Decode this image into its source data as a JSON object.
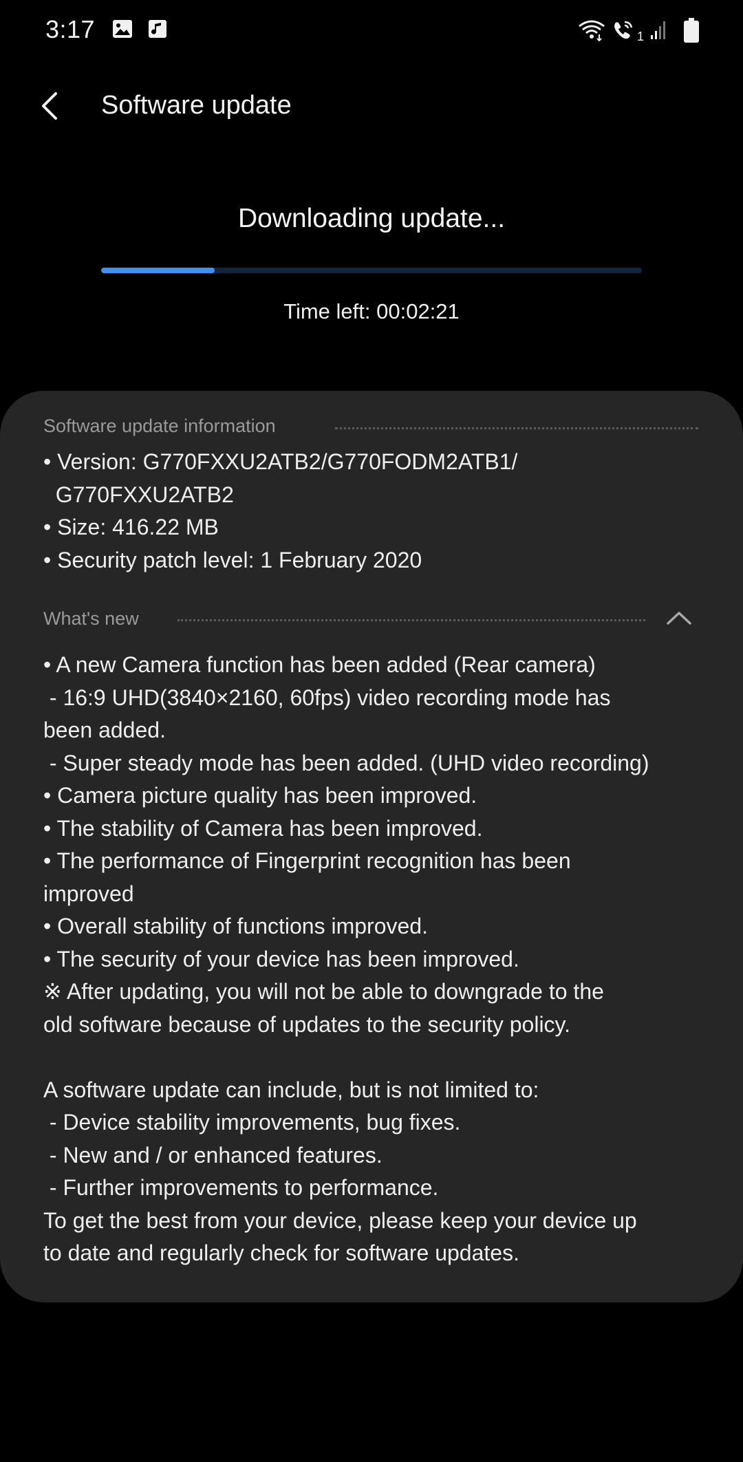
{
  "status_bar": {
    "time": "3:17",
    "left_icons": [
      "gallery-icon",
      "music-note-icon"
    ],
    "right_icons": [
      "wifi-icon",
      "wifi-call-icon",
      "signal-icon",
      "battery-icon"
    ],
    "sim_label": "1"
  },
  "header": {
    "title": "Software update",
    "back_icon": "chevron-left-icon"
  },
  "download": {
    "status": "Downloading update...",
    "progress_percent": 21,
    "time_left": "Time left: 00:02:21",
    "colors": {
      "track": "#0f2540",
      "fill": "#3e91ef"
    }
  },
  "info": {
    "heading": "Software update information",
    "lines": [
      "• Version: G770FXXU2ATB2/G770FODM2ATB1/",
      "  G770FXXU2ATB2",
      "• Size: 416.22 MB",
      "• Security patch level: 1 February 2020"
    ]
  },
  "whats_new": {
    "heading": "What's new",
    "collapse_icon": "chevron-up-icon",
    "lines": [
      "• A new Camera function has been added (Rear camera)",
      " - 16:9 UHD(3840×2160, 60fps) video recording mode has",
      "been added.",
      " - Super steady mode has been added. (UHD video recording)",
      "• Camera picture quality has been improved.",
      "• The stability of Camera has been improved.",
      "• The performance of Fingerprint recognition has been",
      "improved",
      "• Overall stability of functions improved.",
      "• The security of your device has been improved.",
      "※ After updating, you will not be able to downgrade to the",
      "old software because of updates to the security policy.",
      "",
      "A software update can include, but is not limited to:",
      " - Device stability improvements, bug fixes.",
      " - New and / or enhanced features.",
      " - Further improvements to performance.",
      "To get the best from your device, please keep your device up",
      "to date and regularly check for software updates."
    ]
  }
}
